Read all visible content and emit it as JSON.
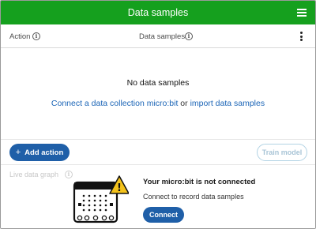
{
  "header": {
    "title": "Data samples",
    "menu_icon": "hamburger-menu-icon"
  },
  "columns": {
    "action_label": "Action",
    "samples_label": "Data samples",
    "info_icon": "i"
  },
  "empty_state": {
    "heading": "No data samples",
    "link_connect": "Connect a data collection micro:bit",
    "joiner": " or ",
    "link_import": "import data samples"
  },
  "actions": {
    "add_plus": "+",
    "add_label": "Add action",
    "train_label": "Train model"
  },
  "live_graph": {
    "label": "Live data graph",
    "status_title": "Your micro:bit is not connected",
    "status_sub": "Connect to record data samples",
    "connect_label": "Connect",
    "warning_glyph": "!"
  },
  "colors": {
    "header_green": "#15a01e",
    "primary_blue": "#1f5fa8",
    "link_blue": "#1a64b6",
    "warning_yellow": "#f3c21b",
    "disabled_border": "#b2d3e4"
  }
}
